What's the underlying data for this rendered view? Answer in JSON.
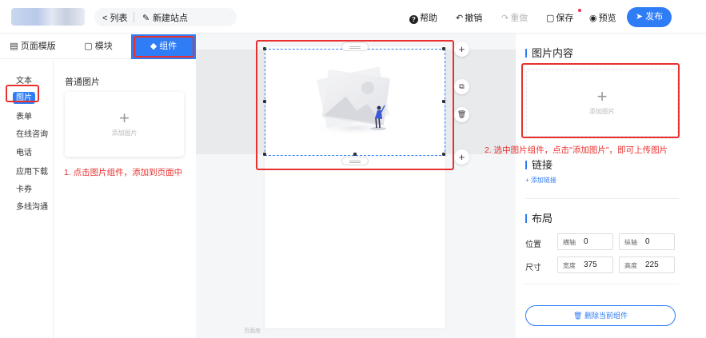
{
  "topbar": {
    "back_label": "< 列表",
    "site_name": "新建站点",
    "help": "帮助",
    "undo": "撤销",
    "redo": "重做",
    "save": "保存",
    "preview": "预览",
    "publish": "发布"
  },
  "tabs": [
    {
      "label": "页面模版"
    },
    {
      "label": "模块"
    },
    {
      "label": "组件"
    }
  ],
  "left_nav": [
    {
      "label": "文本"
    },
    {
      "label": "图片"
    },
    {
      "label": "表单"
    },
    {
      "label": "在线咨询"
    },
    {
      "label": "电话"
    },
    {
      "label": "应用下载"
    },
    {
      "label": "卡券"
    },
    {
      "label": "多线沟通"
    }
  ],
  "library": {
    "section_title": "普通图片",
    "card_label": "添加图片"
  },
  "tips": {
    "step1": "1. 点击图片组件，添加到页面中",
    "step2": "2. 选中图片组件，点击\"添加图片\"，即可上传图片"
  },
  "canvas": {
    "bottom_label": "页面底"
  },
  "right_panel": {
    "image_section_title": "图片内容",
    "upload_label": "添加图片",
    "link_section_title": "链接",
    "add_link": "+ 添加链接",
    "layout_section_title": "布局",
    "position_label": "位置",
    "size_label": "尺寸",
    "x_label": "横轴",
    "x_value": "0",
    "y_label": "纵轴",
    "y_value": "0",
    "width_label": "宽度",
    "width_value": "375",
    "height_label": "高度",
    "height_value": "225",
    "delete_label": "删除当前组件"
  },
  "colors": {
    "accent": "#2e7cf6",
    "annotation": "#e8302f"
  }
}
